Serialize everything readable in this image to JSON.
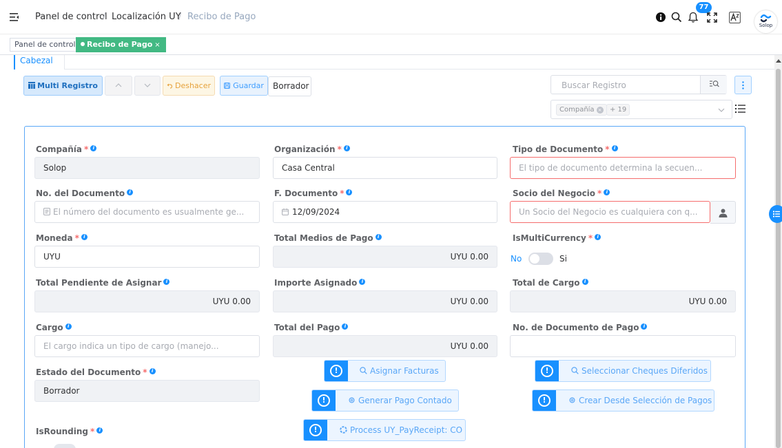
{
  "header": {
    "breadcrumb": [
      "Panel de control",
      "Localización UY",
      "Recibo de Pago"
    ],
    "notifications_count": "77",
    "logo_text": "Solop"
  },
  "tabs": [
    {
      "label": "Panel de control",
      "active": false
    },
    {
      "label": "Recibo de Pago",
      "active": true,
      "close": "×"
    }
  ],
  "section_tab": "Cabezal",
  "toolbar": {
    "multi": "Multi Registro",
    "undo": "Deshacer",
    "save": "Guardar",
    "status": "Borrador"
  },
  "search": {
    "placeholder": "Buscar Registro",
    "filter_chip": "Compañía",
    "more_chip": "+ 19"
  },
  "colors": {
    "primary": "#1890ff",
    "active_tab": "#42b983",
    "required": "#f56c6c",
    "warning": "#e6a23c"
  },
  "fields": {
    "compania": {
      "label": "Compañía",
      "value": "Solop"
    },
    "organizacion": {
      "label": "Organización",
      "value": "Casa Central"
    },
    "tipo_documento": {
      "label": "Tipo de Documento",
      "placeholder": "El tipo de documento determina la secuen..."
    },
    "no_documento": {
      "label": "No. del Documento",
      "placeholder": "El número del documento es usualmente ge..."
    },
    "f_documento": {
      "label": "F. Documento",
      "value": "12/09/2024"
    },
    "socio_negocio": {
      "label": "Socio del Negocio",
      "placeholder": "Un Socio del Negocio es cualquiera con q..."
    },
    "moneda": {
      "label": "Moneda",
      "value": "UYU"
    },
    "total_medios_pago": {
      "label": "Total Medios de Pago",
      "value": "UYU 0.00"
    },
    "is_multi_currency": {
      "label": "IsMultiCurrency",
      "off_label": "No",
      "on_label": "Si",
      "value": false
    },
    "total_pendiente": {
      "label": "Total Pendiente de Asignar",
      "value": "UYU 0.00"
    },
    "importe_asignado": {
      "label": "Importe Asignado",
      "value": "UYU 0.00"
    },
    "total_cargo": {
      "label": "Total de Cargo",
      "value": "UYU 0.00"
    },
    "cargo": {
      "label": "Cargo",
      "placeholder": "El cargo indica un tipo de cargo (manejo..."
    },
    "total_pago": {
      "label": "Total del Pago",
      "value": "UYU 0.00"
    },
    "no_doc_pago": {
      "label": "No. de Documento de Pago",
      "value": ""
    },
    "estado_documento": {
      "label": "Estado del Documento",
      "value": "Borrador"
    },
    "is_rounding": {
      "label": "IsRounding"
    }
  },
  "actions": {
    "asignar_facturas": "Asignar Facturas",
    "seleccionar_cheques": "Seleccionar Cheques Diferidos",
    "generar_pago": "Generar Pago Contado",
    "crear_desde": "Crear Desde Selección de Pagos",
    "process": "Process UY_PayReceipt: CO"
  }
}
